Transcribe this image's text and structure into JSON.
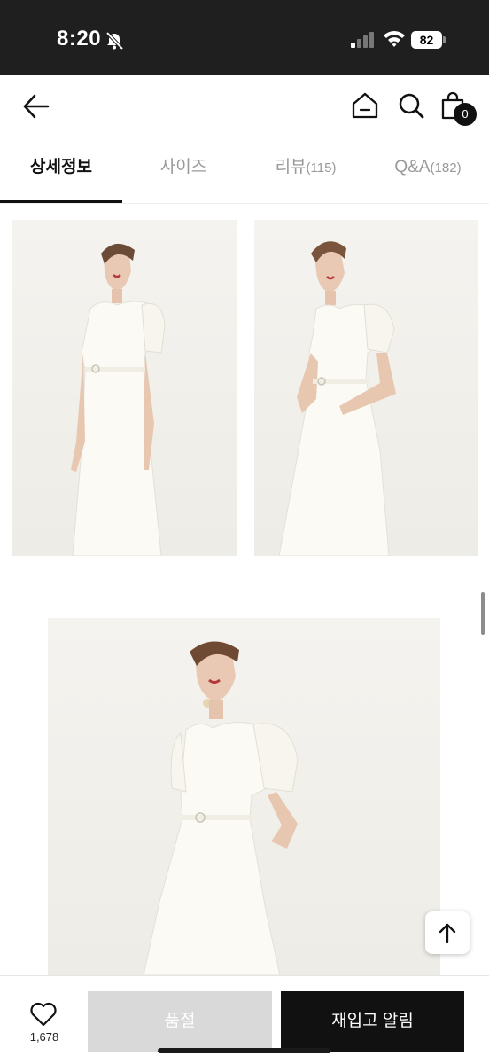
{
  "status_bar": {
    "time": "8:20",
    "battery": "82"
  },
  "nav": {
    "cart_count": "0",
    "icons": [
      "back-arrow-icon",
      "home-icon",
      "search-icon",
      "shopping-bag-icon"
    ]
  },
  "tabs": [
    {
      "label": "상세정보",
      "count": ""
    },
    {
      "label": "사이즈",
      "count": ""
    },
    {
      "label": "리뷰",
      "count": "(115)"
    },
    {
      "label": "Q&A",
      "count": "(182)"
    }
  ],
  "bottom_bar": {
    "like_count": "1,678",
    "soldout_label": "품절",
    "restock_label": "재입고 알림"
  },
  "colors": {
    "accent": "#111111",
    "soldout": "#d9d9d9",
    "status_bar": "#1f1f1f"
  }
}
